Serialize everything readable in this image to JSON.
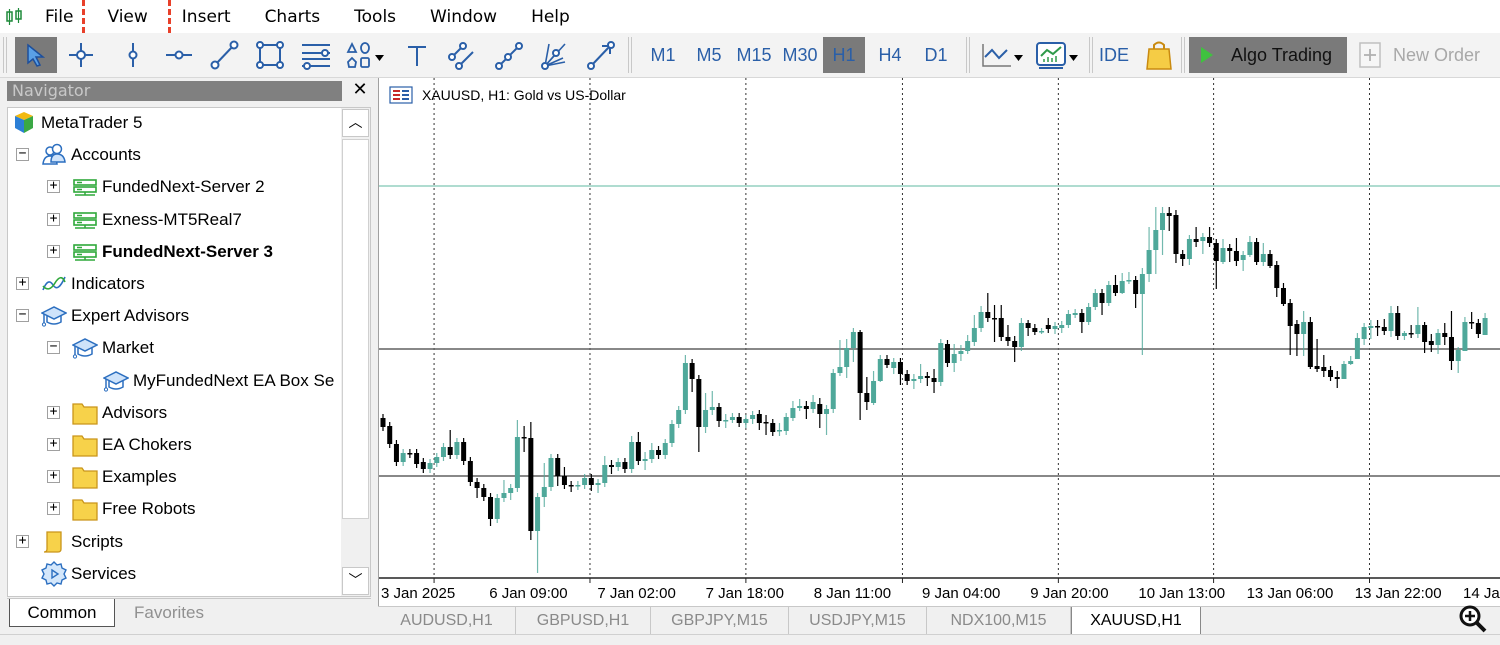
{
  "menu": [
    "File",
    "View",
    "Insert",
    "Charts",
    "Tools",
    "Window",
    "Help"
  ],
  "toolbar": {
    "tools": [
      "cursor-tool",
      "crosshair-tool",
      "vertical-line-tool",
      "horizontal-line-tool",
      "trend-line-tool",
      "rectangle-tool",
      "channel-tool",
      "shapes-tool",
      "text-tool",
      "equidistant-channel-tool",
      "fibonacci-tool",
      "fan-tool",
      "arrow-line-tool"
    ],
    "timeframes": [
      "M1",
      "M5",
      "M15",
      "M30",
      "H1",
      "H4",
      "D1"
    ],
    "active_timeframe": "H1",
    "ide_label": "IDE",
    "algo_trading_label": "Algo Trading",
    "new_order_label": "New Order"
  },
  "navigator": {
    "title": "Navigator",
    "items": [
      {
        "label": "MetaTrader 5",
        "icon": "metatrader-logo-icon",
        "level": 0,
        "expander": ""
      },
      {
        "label": "Accounts",
        "icon": "accounts-icon",
        "level": 1,
        "expander": "−"
      },
      {
        "label": "FundedNext-Server 2",
        "icon": "server-icon",
        "level": 2,
        "expander": "+"
      },
      {
        "label": "Exness-MT5Real7",
        "icon": "server-icon",
        "level": 2,
        "expander": "+"
      },
      {
        "label": "FundedNext-Server 3",
        "icon": "server-icon",
        "level": 2,
        "expander": "+",
        "bold": true
      },
      {
        "label": "Indicators",
        "icon": "indicators-icon",
        "level": 1,
        "expander": "+"
      },
      {
        "label": "Expert Advisors",
        "icon": "graduation-cap-icon",
        "level": 1,
        "expander": "−"
      },
      {
        "label": "Market",
        "icon": "graduation-cap-icon",
        "level": 2,
        "expander": "−"
      },
      {
        "label": "MyFundedNext EA Box Se",
        "icon": "graduation-cap-icon",
        "level": 3,
        "expander": ""
      },
      {
        "label": "Advisors",
        "icon": "folder-icon",
        "level": 2,
        "expander": "+"
      },
      {
        "label": "EA Chokers",
        "icon": "folder-icon",
        "level": 2,
        "expander": "+"
      },
      {
        "label": "Examples",
        "icon": "folder-icon",
        "level": 2,
        "expander": "+"
      },
      {
        "label": "Free Robots",
        "icon": "folder-icon",
        "level": 2,
        "expander": "+"
      },
      {
        "label": "Scripts",
        "icon": "scripts-icon",
        "level": 1,
        "expander": "+"
      },
      {
        "label": "Services",
        "icon": "services-icon",
        "level": 1,
        "expander": ""
      }
    ],
    "tabs": [
      "Common",
      "Favorites"
    ],
    "active_tab": "Common"
  },
  "chart": {
    "title": "XAUUSD, H1:  Gold vs US-Dollar",
    "tabs": [
      "AUDUSD,H1",
      "GBPUSD,H1",
      "GBPJPY,M15",
      "USDJPY,M15",
      "NDX100,M15",
      "XAUUSD,H1"
    ],
    "active_tab": "XAUUSD,H1"
  },
  "chart_data": {
    "type": "candlestick",
    "symbol": "XAUUSD",
    "timeframe": "H1",
    "ylim": [
      2605.5,
      2730.5
    ],
    "x_tick_labels": [
      "3 Jan 2025",
      "6 Jan 09:00",
      "7 Jan 02:00",
      "7 Jan 18:00",
      "8 Jan 11:00",
      "9 Jan 04:00",
      "9 Jan 20:00",
      "10 Jan 13:00",
      "13 Jan 06:00",
      "13 Jan 22:00",
      "14 Ja"
    ],
    "vertical_grid_at_candle": [
      7.6,
      30.8,
      54,
      77.3,
      100.5,
      123.6,
      146.8
    ],
    "horizontal_lines": [
      {
        "price": 2703.5,
        "color": "#5fb8a0"
      },
      {
        "price": 2662.75,
        "color": "#606060"
      },
      {
        "price": 2631,
        "color": "#606060"
      }
    ],
    "colors": {
      "bull": "#4fa89a",
      "bear": "#000000"
    },
    "ohlc": [
      [
        2645.5,
        2646.5,
        2642.25,
        2643.25
      ],
      [
        2643.5,
        2644.5,
        2638,
        2639
      ],
      [
        2639,
        2640,
        2633.5,
        2634.5
      ],
      [
        2634.5,
        2637.75,
        2633.5,
        2636.75
      ],
      [
        2636.75,
        2637.75,
        2635.5,
        2636.5
      ],
      [
        2636.75,
        2637.75,
        2633,
        2634
      ],
      [
        2634.5,
        2635.5,
        2631.75,
        2632.75
      ],
      [
        2632.75,
        2635.25,
        2631.75,
        2634.25
      ],
      [
        2634.25,
        2636.75,
        2633.25,
        2635.75
      ],
      [
        2635.75,
        2639.25,
        2634.75,
        2638.25
      ],
      [
        2638.25,
        2642.5,
        2635.25,
        2636.25
      ],
      [
        2636.25,
        2640.5,
        2635.25,
        2639.5
      ],
      [
        2639.5,
        2640.5,
        2633.75,
        2634.75
      ],
      [
        2634.75,
        2635.75,
        2628.5,
        2629.5
      ],
      [
        2629.5,
        2630.5,
        2625.5,
        2628
      ],
      [
        2628,
        2629,
        2624.75,
        2625.75
      ],
      [
        2625.75,
        2626.75,
        2618.5,
        2620.25
      ],
      [
        2620.25,
        2626.5,
        2619.25,
        2625.5
      ],
      [
        2625.5,
        2630,
        2624.5,
        2626.75
      ],
      [
        2626.75,
        2629,
        2625,
        2628
      ],
      [
        2628,
        2645,
        2627,
        2640.75
      ],
      [
        2640.75,
        2643.5,
        2637,
        2640.5
      ],
      [
        2640.5,
        2644.5,
        2615,
        2617.25
      ],
      [
        2617.25,
        2626.75,
        2606.75,
        2625.75
      ],
      [
        2625.75,
        2634.25,
        2623.25,
        2628.25
      ],
      [
        2628.25,
        2636.5,
        2627.25,
        2635.5
      ],
      [
        2635.5,
        2636.5,
        2628.5,
        2631
      ],
      [
        2631,
        2633.25,
        2627.75,
        2628.75
      ],
      [
        2628.75,
        2629.75,
        2627,
        2628.5
      ],
      [
        2628.5,
        2629.75,
        2627.5,
        2628.75
      ],
      [
        2628.75,
        2631.5,
        2627.75,
        2630.5
      ],
      [
        2630.5,
        2631.5,
        2627.25,
        2628.75
      ],
      [
        2628.75,
        2630.25,
        2626.75,
        2629.25
      ],
      [
        2629.25,
        2636,
        2628.25,
        2633.75
      ],
      [
        2633.75,
        2635,
        2631.5,
        2633.25
      ],
      [
        2633.25,
        2635.5,
        2632.25,
        2634.5
      ],
      [
        2634.5,
        2635.5,
        2631.75,
        2632.75
      ],
      [
        2632.75,
        2641,
        2631.75,
        2639.5
      ],
      [
        2639.5,
        2642,
        2633.75,
        2634.75
      ],
      [
        2634.75,
        2637,
        2632.5,
        2635.25
      ],
      [
        2635.25,
        2639.25,
        2634.25,
        2637.5
      ],
      [
        2637.5,
        2638.5,
        2635.25,
        2636.25
      ],
      [
        2636.25,
        2640.25,
        2635.25,
        2639.25
      ],
      [
        2639.25,
        2645,
        2638.25,
        2644
      ],
      [
        2644,
        2648.5,
        2643,
        2647.5
      ],
      [
        2647.5,
        2661.25,
        2646.5,
        2659.25
      ],
      [
        2659.25,
        2660.25,
        2652,
        2655.25
      ],
      [
        2655.25,
        2656.25,
        2637,
        2643.25
      ],
      [
        2643.25,
        2651.75,
        2641.75,
        2647.5
      ],
      [
        2647.5,
        2652.25,
        2646.25,
        2648.25
      ],
      [
        2648.25,
        2649.25,
        2643.25,
        2644.75
      ],
      [
        2644.75,
        2646.5,
        2643,
        2645
      ],
      [
        2645,
        2646.75,
        2644.25,
        2645.75
      ],
      [
        2645.75,
        2646.75,
        2643.25,
        2644.25
      ],
      [
        2644.25,
        2646.25,
        2643,
        2645.25
      ],
      [
        2645.25,
        2647.25,
        2644,
        2646.25
      ],
      [
        2646.5,
        2647.5,
        2642.5,
        2644.25
      ],
      [
        2644.5,
        2646.25,
        2641.25,
        2644.25
      ],
      [
        2644.25,
        2645.25,
        2641,
        2642
      ],
      [
        2642.25,
        2644.25,
        2641,
        2642.5
      ],
      [
        2642.25,
        2646.75,
        2641.25,
        2645.75
      ],
      [
        2645.5,
        2649.75,
        2644.75,
        2648
      ],
      [
        2648,
        2650.25,
        2647.25,
        2648.5
      ],
      [
        2648.5,
        2649.75,
        2645.25,
        2647.75
      ],
      [
        2647.75,
        2651.25,
        2646.75,
        2649.5
      ],
      [
        2649,
        2650.5,
        2643,
        2646.5
      ],
      [
        2646.5,
        2648.75,
        2641.25,
        2647.75
      ],
      [
        2647.75,
        2657.75,
        2646.75,
        2656.75
      ],
      [
        2656.75,
        2665,
        2656,
        2658.25
      ],
      [
        2658.25,
        2665.25,
        2655.5,
        2663
      ],
      [
        2663,
        2668,
        2659.5,
        2667
      ],
      [
        2667,
        2667.5,
        2645,
        2651.75
      ],
      [
        2651.75,
        2655.75,
        2647.5,
        2649.5
      ],
      [
        2649.25,
        2657.25,
        2648.75,
        2654.75
      ],
      [
        2654.75,
        2661.25,
        2654.5,
        2660.25
      ],
      [
        2660.25,
        2661.25,
        2658,
        2658.75
      ],
      [
        2658,
        2660.5,
        2656.5,
        2659.5
      ],
      [
        2659.5,
        2660.5,
        2653.75,
        2656.5
      ],
      [
        2656.5,
        2657.5,
        2653.75,
        2654.75
      ],
      [
        2654.75,
        2656.5,
        2652.75,
        2655.25
      ],
      [
        2655.25,
        2659,
        2654.25,
        2656
      ],
      [
        2656,
        2657,
        2653.5,
        2655.5
      ],
      [
        2655.5,
        2657.75,
        2651.75,
        2654.5
      ],
      [
        2654.5,
        2665.25,
        2653.5,
        2664.25
      ],
      [
        2664,
        2665,
        2658.25,
        2659.25
      ],
      [
        2659.25,
        2664,
        2657,
        2661.5
      ],
      [
        2661.5,
        2663.75,
        2659.75,
        2662.25
      ],
      [
        2662.25,
        2666.25,
        2661.5,
        2664.75
      ],
      [
        2664.5,
        2671.25,
        2663.5,
        2668
      ],
      [
        2668,
        2673.5,
        2667,
        2672
      ],
      [
        2672,
        2676.75,
        2669.5,
        2670.5
      ],
      [
        2670.5,
        2673.75,
        2664.5,
        2670.25
      ],
      [
        2670.5,
        2673.75,
        2664.75,
        2665.75
      ],
      [
        2665.75,
        2668.75,
        2663.5,
        2664.75
      ],
      [
        2664.75,
        2666,
        2659.5,
        2663.25
      ],
      [
        2663.25,
        2670.5,
        2662.25,
        2669.25
      ],
      [
        2669.25,
        2670,
        2666,
        2668
      ],
      [
        2668,
        2669,
        2666.25,
        2667
      ],
      [
        2667,
        2668,
        2666.5,
        2667.25
      ],
      [
        2668.75,
        2670.5,
        2666.75,
        2667.75
      ],
      [
        2667.75,
        2669.5,
        2666.5,
        2668.5
      ],
      [
        2668,
        2669.75,
        2666.75,
        2668.75
      ],
      [
        2668.75,
        2672.5,
        2668,
        2671.5
      ],
      [
        2671.25,
        2672.75,
        2670.5,
        2671.75
      ],
      [
        2671.75,
        2672.75,
        2666.75,
        2669.5
      ],
      [
        2669.5,
        2674.25,
        2668.75,
        2673.25
      ],
      [
        2673.25,
        2677.75,
        2672.5,
        2676.75
      ],
      [
        2676.75,
        2677.75,
        2671.25,
        2674.25
      ],
      [
        2674.25,
        2679.75,
        2673.5,
        2678.75
      ],
      [
        2678.75,
        2681.25,
        2676,
        2676.75
      ],
      [
        2676.75,
        2681.75,
        2676.5,
        2679.75
      ],
      [
        2679.75,
        2682,
        2679,
        2680
      ],
      [
        2680,
        2681,
        2673,
        2676.5
      ],
      [
        2676.5,
        2683,
        2661.25,
        2681.5
      ],
      [
        2681.5,
        2693.25,
        2679.5,
        2687.5
      ],
      [
        2687.5,
        2698.25,
        2681.5,
        2692.5
      ],
      [
        2692.5,
        2698.25,
        2686.25,
        2696.75
      ],
      [
        2696.75,
        2698.25,
        2692.25,
        2696
      ],
      [
        2696.25,
        2697.5,
        2684.25,
        2686.5
      ],
      [
        2686.5,
        2687.5,
        2683.5,
        2685.25
      ],
      [
        2685.25,
        2691.25,
        2683.75,
        2690.25
      ],
      [
        2690.25,
        2693.25,
        2688.25,
        2689.5
      ],
      [
        2689.75,
        2691.75,
        2686.5,
        2690.75
      ],
      [
        2690.75,
        2693.25,
        2688.25,
        2689.25
      ],
      [
        2689.25,
        2690.25,
        2677.75,
        2684.75
      ],
      [
        2684.5,
        2690.25,
        2684,
        2688
      ],
      [
        2688,
        2689,
        2684.5,
        2687.25
      ],
      [
        2687.25,
        2690.5,
        2683.5,
        2684.75
      ],
      [
        2685,
        2687.25,
        2682.25,
        2686.25
      ],
      [
        2686.25,
        2691,
        2685.75,
        2689.5
      ],
      [
        2689.5,
        2690.5,
        2683.75,
        2684.5
      ],
      [
        2684.5,
        2689.25,
        2683.5,
        2686.5
      ],
      [
        2686.5,
        2687.5,
        2683,
        2683.5
      ],
      [
        2683.75,
        2684.75,
        2675.75,
        2678
      ],
      [
        2678,
        2679.25,
        2673.5,
        2674
      ],
      [
        2674.25,
        2675.25,
        2661.25,
        2668.5
      ],
      [
        2669,
        2670,
        2661,
        2666.5
      ],
      [
        2666.5,
        2672.25,
        2661,
        2669.5
      ],
      [
        2669.5,
        2670.75,
        2657.75,
        2658.25
      ],
      [
        2658.5,
        2665.25,
        2657,
        2657.75
      ],
      [
        2658.25,
        2661.25,
        2655.75,
        2657.25
      ],
      [
        2657.5,
        2658.5,
        2654.75,
        2655.75
      ],
      [
        2655.75,
        2657.25,
        2653,
        2655.25
      ],
      [
        2655.25,
        2659.75,
        2655.25,
        2659
      ],
      [
        2659,
        2661,
        2658.75,
        2659.75
      ],
      [
        2660.25,
        2666.75,
        2660.25,
        2665.5
      ],
      [
        2665.25,
        2669.25,
        2663.75,
        2668.25
      ],
      [
        2668,
        2670,
        2665.25,
        2668.5
      ],
      [
        2668.5,
        2670,
        2666,
        2668.25
      ],
      [
        2668.25,
        2670.25,
        2666.25,
        2667.25
      ],
      [
        2667.25,
        2673.5,
        2665.75,
        2671.75
      ],
      [
        2671.75,
        2673.5,
        2665,
        2666
      ],
      [
        2666,
        2667.25,
        2665,
        2666.75
      ],
      [
        2666.75,
        2668.75,
        2665.5,
        2666.5
      ],
      [
        2666.5,
        2673.25,
        2665.5,
        2668.75
      ],
      [
        2668.75,
        2669.5,
        2661.75,
        2664.5
      ],
      [
        2664.75,
        2666.5,
        2662,
        2663.75
      ],
      [
        2663.75,
        2667.75,
        2661.5,
        2666.75
      ],
      [
        2666.75,
        2669.25,
        2663.75,
        2665.75
      ],
      [
        2665.75,
        2672.25,
        2657.5,
        2659.75
      ],
      [
        2659.75,
        2663.25,
        2656.75,
        2662.5
      ],
      [
        2662.25,
        2670.75,
        2662.25,
        2669.5
      ],
      [
        2669.5,
        2672,
        2667.75,
        2669.25
      ],
      [
        2669.25,
        2670.25,
        2665.5,
        2666.5
      ],
      [
        2666.25,
        2671.75,
        2666.25,
        2670.5
      ]
    ]
  }
}
